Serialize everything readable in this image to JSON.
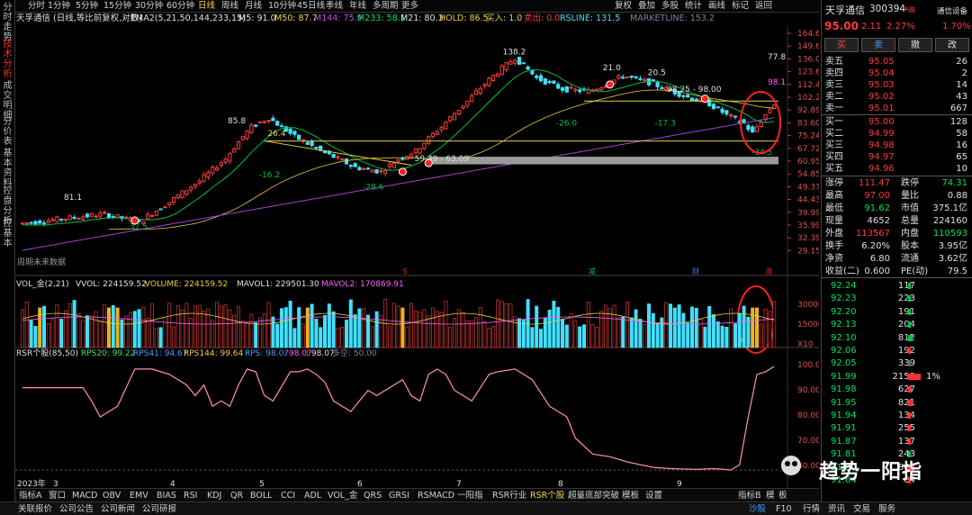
{
  "sidebar": {
    "tabs": [
      {
        "label": "分时走势",
        "active": false
      },
      {
        "label": "技术分析",
        "active": true
      },
      {
        "label": "成交明细",
        "active": false
      },
      {
        "label": "分价表",
        "active": false
      },
      {
        "label": "基本资料",
        "active": false
      },
      {
        "label": "控盘分析",
        "active": false
      },
      {
        "label": "控基本",
        "active": false
      }
    ]
  },
  "toolbar": {
    "periods": [
      "分时",
      "1分钟",
      "5分钟",
      "15分钟",
      "30分钟",
      "60分钟",
      "日线",
      "周线",
      "月线",
      "10分钟",
      "45日线",
      "季线",
      "年线",
      "多周期",
      "更多"
    ],
    "active_period": "日线",
    "right_buttons": [
      "复权",
      "叠加",
      "多股",
      "统计",
      "画线",
      "标记",
      "返回"
    ]
  },
  "info_line": {
    "title": "天孚通信 (日线,等比前复权,对数)",
    "ema": "EMA2(5,21,50,144,233,15)",
    "m5": "M5: 91.0",
    "m50": "M50: 87.7",
    "m144": "M144: 75.9",
    "m233": "M233: 58.1",
    "m21": "M21: 80.3",
    "hold": "HOLD: 86.5",
    "buy": "买入: 1.0",
    "sell": "卖出: 0.0",
    "rsline": "RSLINE: 131.5",
    "marketline": "MARKETLINE: 153.2"
  },
  "price_axis": [
    "164.6",
    "149.6",
    "136.0",
    "123.6",
    "112.4",
    "102.2",
    "92.89",
    "83.60",
    "75.24",
    "67.72",
    "60.95",
    "54.85",
    "49.37",
    "44.43",
    "39.99",
    "35.99",
    "32.39",
    "29.15"
  ],
  "price_annotations": {
    "p138": "138.2",
    "p210": "21.0",
    "p205": "20.5",
    "range": "98.25 - 98.00",
    "p778": "77.8",
    "p981": "98.1",
    "p264": "26.4",
    "p858": "85.8",
    "p811": "81.1",
    "n162": "-16.2",
    "n286": "-28.6",
    "n260": "-26.0",
    "n173": "-17.3",
    "n345": "-34.5",
    "p375": "37.5",
    "range2": "59.39 - 63.09",
    "note": "周期未来数据"
  },
  "events": [
    "S",
    "减",
    "财",
    "涨"
  ],
  "vol_info": {
    "name": "VOL_金(2,21)",
    "vvol": "VVOL: 224159.52",
    "volume": "VOLUME: 224159.52",
    "mavol1": "MAVOL1: 229501.30",
    "mavol2": "MAVOL2: 170869.91"
  },
  "vol_axis": [
    "30000",
    "15000",
    "X10"
  ],
  "rsr_info": {
    "name": "RSR个股(85,50)",
    "rps20": "RPS20: 99.22",
    "rps41": "RPS41: 94.67",
    "rps144": "RPS144: 99.64",
    "rps": "RPS: 98.07",
    "rps2": ": 98.07",
    "rps3": ": 98.07",
    "duo": "多空: 50.00"
  },
  "rsr_axis": [
    "100.0",
    "90.00",
    "80.00",
    "70.00",
    "60.00"
  ],
  "time_axis": [
    "2023年",
    "3",
    "4",
    "5",
    "6",
    "7",
    "8",
    "9"
  ],
  "bottom_tabs": [
    "指标A",
    "窗口",
    "MACD",
    "OBV",
    "EMV",
    "BIAS",
    "RSI",
    "KDJ",
    "QR",
    "BOLL",
    "CCI",
    "ADL",
    "VOL_金",
    "QRS",
    "GRSI",
    "RSMACD",
    "一阳指",
    "RSR行业",
    "RSR个股",
    "超量底部突破",
    "模板",
    "设置"
  ],
  "bottom_active": "RSR个股",
  "bottom_right": [
    "指标B",
    "模",
    "板"
  ],
  "status": [
    "关联报价",
    "公司公告",
    "公司新闻",
    "公司研报"
  ],
  "status_right": [
    "沙股",
    "F10",
    "行情",
    "资讯",
    "交易",
    "服务"
  ],
  "watermark": "趋势一阳指",
  "quote": {
    "name": "天孚通信",
    "code": "300394",
    "tag": "R融",
    "settings": "通信设备",
    "price": "95.00",
    "change": "2.11",
    "pct": "2.27%",
    "side_pct": "1.70%",
    "buttons": [
      "买",
      "卖",
      "撤",
      "改"
    ],
    "asks": [
      {
        "label": "卖五",
        "price": "95.05",
        "vol": "26"
      },
      {
        "label": "卖四",
        "price": "95.04",
        "vol": "2"
      },
      {
        "label": "卖三",
        "price": "95.03",
        "vol": "14"
      },
      {
        "label": "卖二",
        "price": "95.02",
        "vol": "43"
      },
      {
        "label": "卖一",
        "price": "95.01",
        "vol": "667"
      }
    ],
    "bids": [
      {
        "label": "买一",
        "price": "95.00",
        "vol": "128"
      },
      {
        "label": "买二",
        "price": "94.99",
        "vol": "58"
      },
      {
        "label": "买三",
        "price": "94.98",
        "vol": "16"
      },
      {
        "label": "买四",
        "price": "94.97",
        "vol": "65"
      },
      {
        "label": "买五",
        "price": "94.96",
        "vol": "10"
      }
    ],
    "stats": [
      {
        "l1": "涨停",
        "v1": "111.47",
        "l2": "跌停",
        "v2": "74.31",
        "c1": "red",
        "c2": "green"
      },
      {
        "l1": "最高",
        "v1": "97.00",
        "l2": "量比",
        "v2": "0.88",
        "c1": "red",
        "c2": "white"
      },
      {
        "l1": "最低",
        "v1": "91.62",
        "l2": "市值",
        "v2": "375.1亿",
        "c1": "green",
        "c2": "white"
      },
      {
        "l1": "现量",
        "v1": "4652",
        "l2": "总量",
        "v2": "224160",
        "c1": "white",
        "c2": "white"
      },
      {
        "l1": "外盘",
        "v1": "113567",
        "l2": "内盘",
        "v2": "110593",
        "c1": "red",
        "c2": "green"
      },
      {
        "l1": "换手",
        "v1": "6.20%",
        "l2": "股本",
        "v2": "3.95亿",
        "c1": "white",
        "c2": "white"
      },
      {
        "l1": "净资",
        "v1": "6.80",
        "l2": "流通",
        "v2": "3.62亿",
        "c1": "white",
        "c2": "white"
      },
      {
        "l1": "收益(二)",
        "v1": "0.600",
        "l2": "PE(动)",
        "v2": "79.5",
        "c1": "white",
        "c2": "white"
      }
    ],
    "ticks": [
      {
        "price": "92.24",
        "vol": "117",
        "pct": ""
      },
      {
        "price": "92.23",
        "vol": "223",
        "pct": ""
      },
      {
        "price": "92.20",
        "vol": "191",
        "pct": ""
      },
      {
        "price": "92.13",
        "vol": "204",
        "pct": ""
      },
      {
        "price": "92.10",
        "vol": "812",
        "pct": ""
      },
      {
        "price": "92.06",
        "vol": "192",
        "pct": ""
      },
      {
        "price": "92.05",
        "vol": "339",
        "pct": ""
      },
      {
        "price": "91.99",
        "vol": "2150",
        "pct": "1%"
      },
      {
        "price": "91.98",
        "vol": "627",
        "pct": ""
      },
      {
        "price": "91.95",
        "vol": "821",
        "pct": ""
      },
      {
        "price": "91.94",
        "vol": "134",
        "pct": ""
      },
      {
        "price": "91.91",
        "vol": "255",
        "pct": ""
      },
      {
        "price": "91.87",
        "vol": "137",
        "pct": ""
      },
      {
        "price": "91.81",
        "vol": "243",
        "pct": ""
      },
      {
        "price": "91.80",
        "vol": "862",
        "pct": ""
      },
      {
        "price": "91.64",
        "vol": "64",
        "pct": ""
      },
      {
        "price": "91.62",
        "vol": "68",
        "pct": ""
      }
    ]
  },
  "colors": {
    "up": "#ff3b3b",
    "down": "#40e0ff",
    "ma_green": "#00c040",
    "ma_purple": "#a040d0",
    "ma_yellow": "#e0d040",
    "rsr": "#ff80c0"
  }
}
